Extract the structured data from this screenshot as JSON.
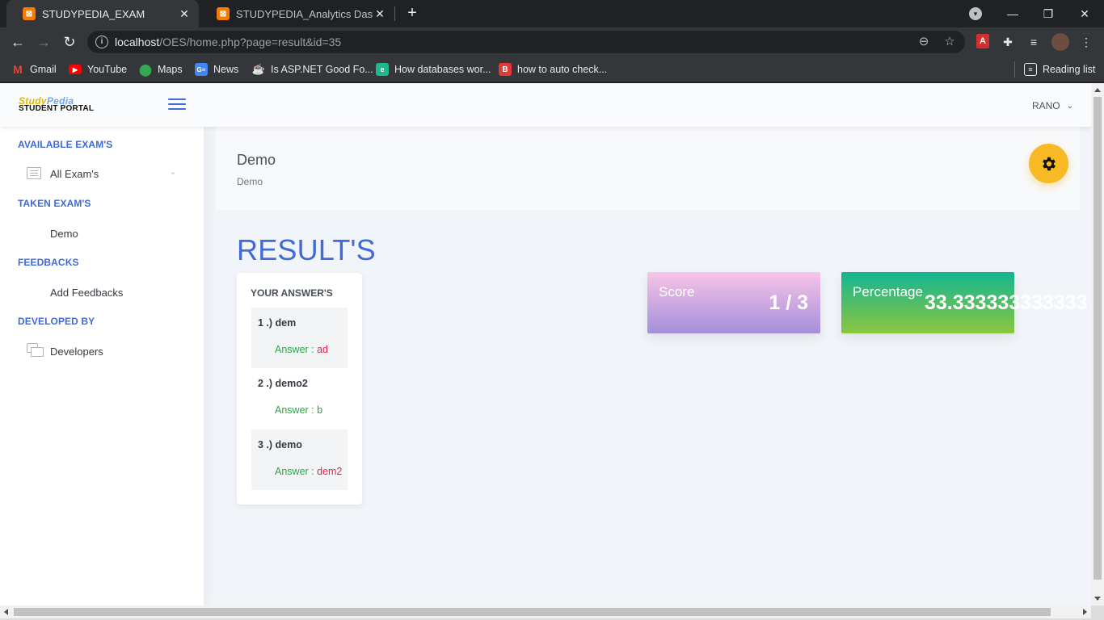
{
  "browser": {
    "tabs": [
      {
        "title": "STUDYPEDIA_EXAM",
        "active": true
      },
      {
        "title": "STUDYPEDIA_Analytics Dashboard",
        "active": false
      }
    ],
    "url_host": "localhost",
    "url_path": "/OES/home.php?page=result&id=35",
    "bookmarks": [
      {
        "label": "Gmail",
        "icon": "gmail-icon",
        "color": "#ea4335"
      },
      {
        "label": "YouTube",
        "icon": "youtube-icon",
        "color": "#ff0000"
      },
      {
        "label": "Maps",
        "icon": "maps-icon",
        "color": "#34a853"
      },
      {
        "label": "News",
        "icon": "news-icon",
        "color": "#4285f4"
      },
      {
        "label": "Is ASP.NET Good Fo...",
        "icon": "coffee-icon",
        "color": "#e8eaed"
      },
      {
        "label": "How databases wor...",
        "icon": "educative-icon",
        "color": "#1db88e"
      },
      {
        "label": "how to auto check...",
        "icon": "b-icon",
        "color": "#e53935"
      }
    ],
    "reading_list": "Reading list"
  },
  "header": {
    "logo_line1_a": "Study",
    "logo_line1_b": "Pedia",
    "logo_line2": "STUDENT PORTAL",
    "user_name": "RANO"
  },
  "sidebar": {
    "sections": [
      {
        "heading": "AVAILABLE EXAM'S",
        "item": "All Exam's",
        "icon": "list-icon"
      },
      {
        "heading": "TAKEN EXAM'S",
        "item": "Demo",
        "icon": ""
      },
      {
        "heading": "FEEDBACKS",
        "item": "Add Feedbacks",
        "icon": ""
      },
      {
        "heading": "DEVELOPED BY",
        "item": "Developers",
        "icon": "chat-icon"
      }
    ]
  },
  "page_title": {
    "title": "Demo",
    "subtitle": "Demo"
  },
  "result": {
    "heading": "RESULT'S",
    "answers_heading": "YOUR ANSWER'S",
    "answer_prefix": "Answer : ",
    "questions": [
      {
        "label": "1 .) dem",
        "answer": "ad",
        "correct": false
      },
      {
        "label": "2 .) demo2",
        "answer": "b",
        "correct": true
      },
      {
        "label": "3 .) demo",
        "answer": "dem2",
        "correct": false
      }
    ],
    "score_label": "Score",
    "score_value": "1 / 3",
    "percentage_label": "Percentage",
    "percentage_value": "33.333333333333"
  },
  "colors": {
    "accent": "#3f6ad8",
    "correct": "#28a745",
    "wrong": "#d92550",
    "gear_button": "#f7b924"
  }
}
